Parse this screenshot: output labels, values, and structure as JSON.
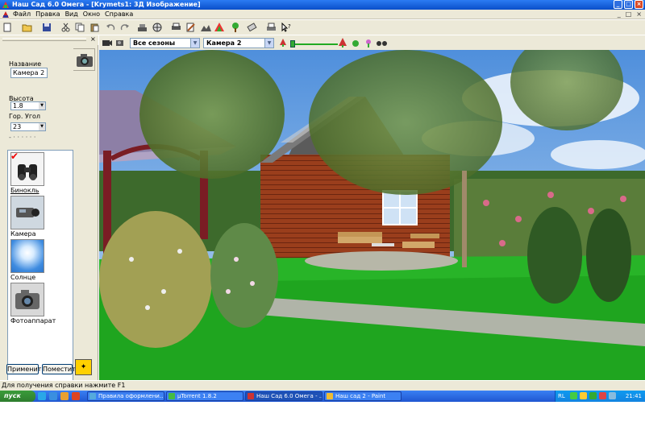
{
  "window": {
    "title": "Наш Сад 6.0 Омега - [Krymets1: 3Д Изображение]",
    "controls": [
      "_",
      "□",
      "×"
    ]
  },
  "menu": {
    "items": [
      "Файл",
      "Правка",
      "Вид",
      "Окно",
      "Справка"
    ],
    "mdi_controls": [
      "_",
      "□",
      "×"
    ]
  },
  "toolbar": {
    "season": "Все сезоны",
    "camera": "Камера 2"
  },
  "panel": {
    "name_label": "Название",
    "name_value": "Камера 2",
    "height_label": "Высота",
    "height_value": "1.8",
    "angle_label": "Гор. Угол",
    "angle_value": "23",
    "items": [
      {
        "name": "Бинокль",
        "selected": true
      },
      {
        "name": "Камера",
        "selected": false
      },
      {
        "name": "Солнце",
        "selected": false
      },
      {
        "name": "Фотоаппарат",
        "selected": false
      }
    ],
    "apply_button": "Применить",
    "place_button": "Поместить"
  },
  "status": {
    "text": "Для получения справки нажмите F1"
  },
  "taskbar": {
    "start_label": "пуск",
    "tasks": [
      {
        "label": "Правила оформлени...",
        "active": false
      },
      {
        "label": "µTorrent 1.8.2",
        "active": false
      },
      {
        "label": "Наш Сад 6.0 Омега - ...",
        "active": true
      },
      {
        "label": "Наш сад 2 - Paint",
        "active": false
      }
    ],
    "lang": "RL",
    "clock": "21:41"
  }
}
